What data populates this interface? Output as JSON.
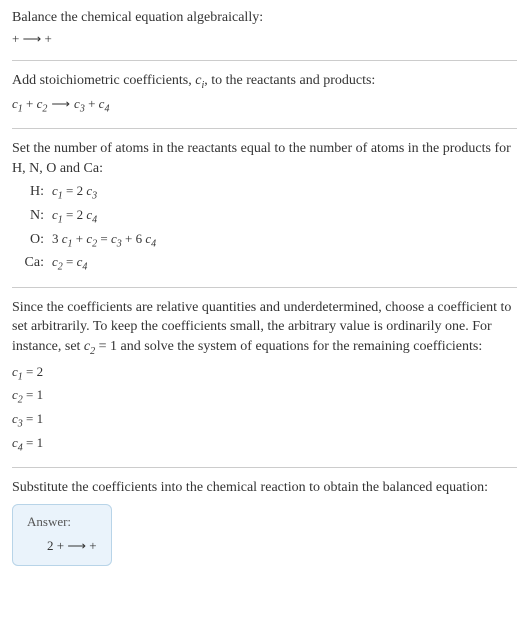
{
  "section1": {
    "intro": "Balance the chemical equation algebraically:",
    "equation": " +  ⟶  + "
  },
  "section2": {
    "intro_pre": "Add stoichiometric coefficients, ",
    "intro_var": "c",
    "intro_sub": "i",
    "intro_post": ", to the reactants and products:",
    "eq": {
      "c1": "c",
      "s1": "1",
      "plus1": " + ",
      "c2": "c",
      "s2": "2",
      "arrow": " ⟶ ",
      "c3": "c",
      "s3": "3",
      "plus2": " + ",
      "c4": "c",
      "s4": "4"
    }
  },
  "section3": {
    "intro": "Set the number of atoms in the reactants equal to the number of atoms in the products for H, N, O and Ca:",
    "rows": [
      {
        "label": "H:",
        "lhs_c": "c",
        "lhs_s": "1",
        "eq": " = 2 ",
        "rhs_c": "c",
        "rhs_s": "3",
        "extra": ""
      },
      {
        "label": "N:",
        "lhs_c": "c",
        "lhs_s": "1",
        "eq": " = 2 ",
        "rhs_c": "c",
        "rhs_s": "4",
        "extra": ""
      },
      {
        "label": "O:",
        "pre": "3 ",
        "lhs_c": "c",
        "lhs_s": "1",
        "mid": " + ",
        "mid_c": "c",
        "mid_s": "2",
        "eq": " = ",
        "rhs_c": "c",
        "rhs_s": "3",
        "extra": " + 6 ",
        "ex_c": "c",
        "ex_s": "4"
      },
      {
        "label": "Ca:",
        "lhs_c": "c",
        "lhs_s": "2",
        "eq": " = ",
        "rhs_c": "c",
        "rhs_s": "4",
        "extra": ""
      }
    ]
  },
  "section4": {
    "intro_a": "Since the coefficients are relative quantities and underdetermined, choose a coefficient to set arbitrarily. To keep the coefficients small, the arbitrary value is ordinarily one. For instance, set ",
    "intro_c": "c",
    "intro_s": "2",
    "intro_b": " = 1 and solve the system of equations for the remaining coefficients:",
    "results": [
      {
        "c": "c",
        "s": "1",
        "val": " = 2"
      },
      {
        "c": "c",
        "s": "2",
        "val": " = 1"
      },
      {
        "c": "c",
        "s": "3",
        "val": " = 1"
      },
      {
        "c": "c",
        "s": "4",
        "val": " = 1"
      }
    ]
  },
  "section5": {
    "intro": "Substitute the coefficients into the chemical reaction to obtain the balanced equation:",
    "answer_label": "Answer:",
    "answer_eq": "2  +  ⟶  + "
  }
}
